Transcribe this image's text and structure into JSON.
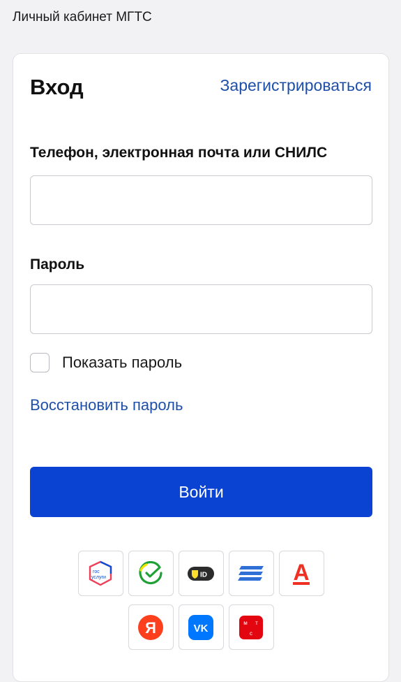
{
  "header": {
    "title": "Личный кабинет МГТС"
  },
  "card": {
    "title": "Вход",
    "register_label": "Зарегистрироваться",
    "login_field": {
      "label": "Телефон, электронная почта или СНИЛС",
      "value": "",
      "placeholder": ""
    },
    "password_field": {
      "label": "Пароль",
      "value": "",
      "placeholder": ""
    },
    "show_password_label": "Показать пароль",
    "recover_label": "Восстановить пароль",
    "submit_label": "Войти"
  },
  "providers": {
    "gosuslugi_line1": "гос",
    "gosuslugi_line2": "услуги",
    "tid_text": "ID",
    "alfa_letter": "А",
    "yandex_letter": "Я",
    "vk_text": "VK",
    "mts_letters": [
      "м",
      "т",
      "с"
    ],
    "icons": [
      "gosuslugi-icon",
      "sber-icon",
      "tinkoff-id-icon",
      "gazprom-icon",
      "alfa-bank-icon",
      "yandex-icon",
      "vk-icon",
      "mts-icon"
    ]
  },
  "colors": {
    "accent": "#0a43d1",
    "link": "#1d4fa8",
    "background": "#f2f2f4",
    "alfa_red": "#ef3124",
    "yandex_red": "#fc3f1d",
    "vk_blue": "#0077ff",
    "mts_red": "#e30611",
    "tinkoff_yellow": "#ffdd2d"
  }
}
